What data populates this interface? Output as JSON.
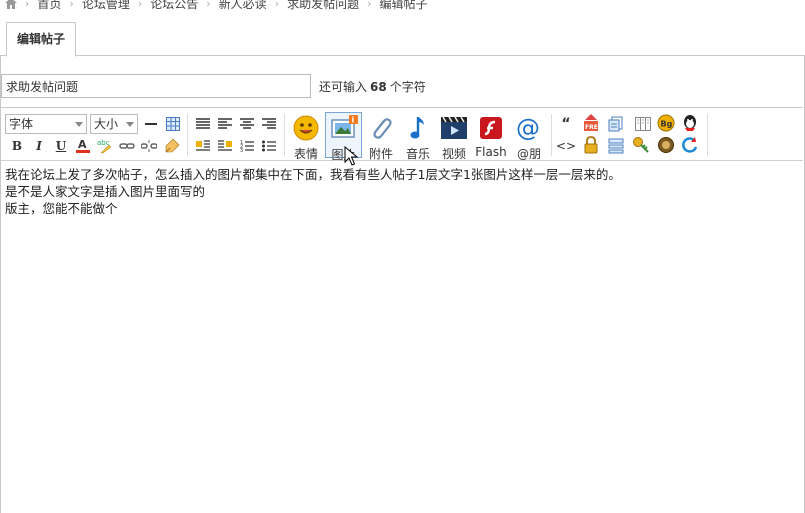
{
  "breadcrumb": {
    "items": [
      "首页",
      "论坛管理",
      "论坛公告",
      "新人必读",
      "求助发帖问题",
      "编辑帖子"
    ]
  },
  "tab": {
    "label": "编辑帖子"
  },
  "subject": {
    "value": "求助发帖问题",
    "remain_prefix": "还可输入",
    "remain_count": "68",
    "remain_suffix": "个字符"
  },
  "toolbar": {
    "font_select": "字体",
    "size_select": "大小",
    "emoji_label": "表情",
    "image_label": "图片",
    "attach_label": "附件",
    "music_label": "音乐",
    "video_label": "视频",
    "flash_label": "Flash",
    "at_label": "@朋"
  },
  "content": {
    "lines": [
      "我在论坛上发了多次帖子，怎么插入的图片都集中在下面，我看有些人帖子1层文字1张图片这样一层一层来的。",
      "是不是人家文字是插入图片里面写的",
      "版主，您能不能做个"
    ]
  },
  "colors": {
    "border": "#c8c8c8",
    "accent": "#7aa6d6"
  }
}
